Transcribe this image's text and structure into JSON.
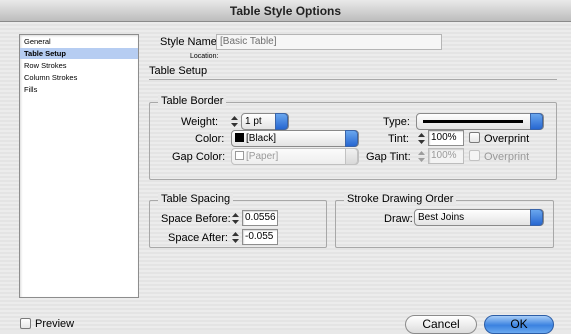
{
  "window": {
    "title": "Table Style Options"
  },
  "sidebar": {
    "items": [
      {
        "label": "General"
      },
      {
        "label": "Table Setup"
      },
      {
        "label": "Row Strokes"
      },
      {
        "label": "Column Strokes"
      },
      {
        "label": "Fills"
      }
    ],
    "selected": "Table Setup"
  },
  "style_name": {
    "label": "Style Name:",
    "value": "[Basic Table]"
  },
  "location": {
    "label": "Location:"
  },
  "section": {
    "title": "Table Setup"
  },
  "table_border": {
    "title": "Table Border",
    "weight_label": "Weight:",
    "weight_value": "1 pt",
    "type_label": "Type:",
    "color_label": "Color:",
    "color_value": "[Black]",
    "tint_label": "Tint:",
    "tint_value": "100%",
    "overprint_label": "Overprint",
    "gap_color_label": "Gap Color:",
    "gap_color_value": "[Paper]",
    "gap_tint_label": "Gap Tint:",
    "gap_tint_value": "100%",
    "gap_overprint_label": "Overprint"
  },
  "table_spacing": {
    "title": "Table Spacing",
    "space_before_label": "Space Before:",
    "space_before_value": "0.0556",
    "space_after_label": "Space After:",
    "space_after_value": "-0.055"
  },
  "stroke_order": {
    "title": "Stroke Drawing Order",
    "draw_label": "Draw:",
    "draw_value": "Best Joins"
  },
  "footer": {
    "preview_label": "Preview",
    "cancel_label": "Cancel",
    "ok_label": "OK"
  },
  "colors": {
    "accent": "#3b82e0",
    "selection": "#b6cdf2",
    "swatch_black": "#000000",
    "swatch_paper": "#ffffff"
  }
}
